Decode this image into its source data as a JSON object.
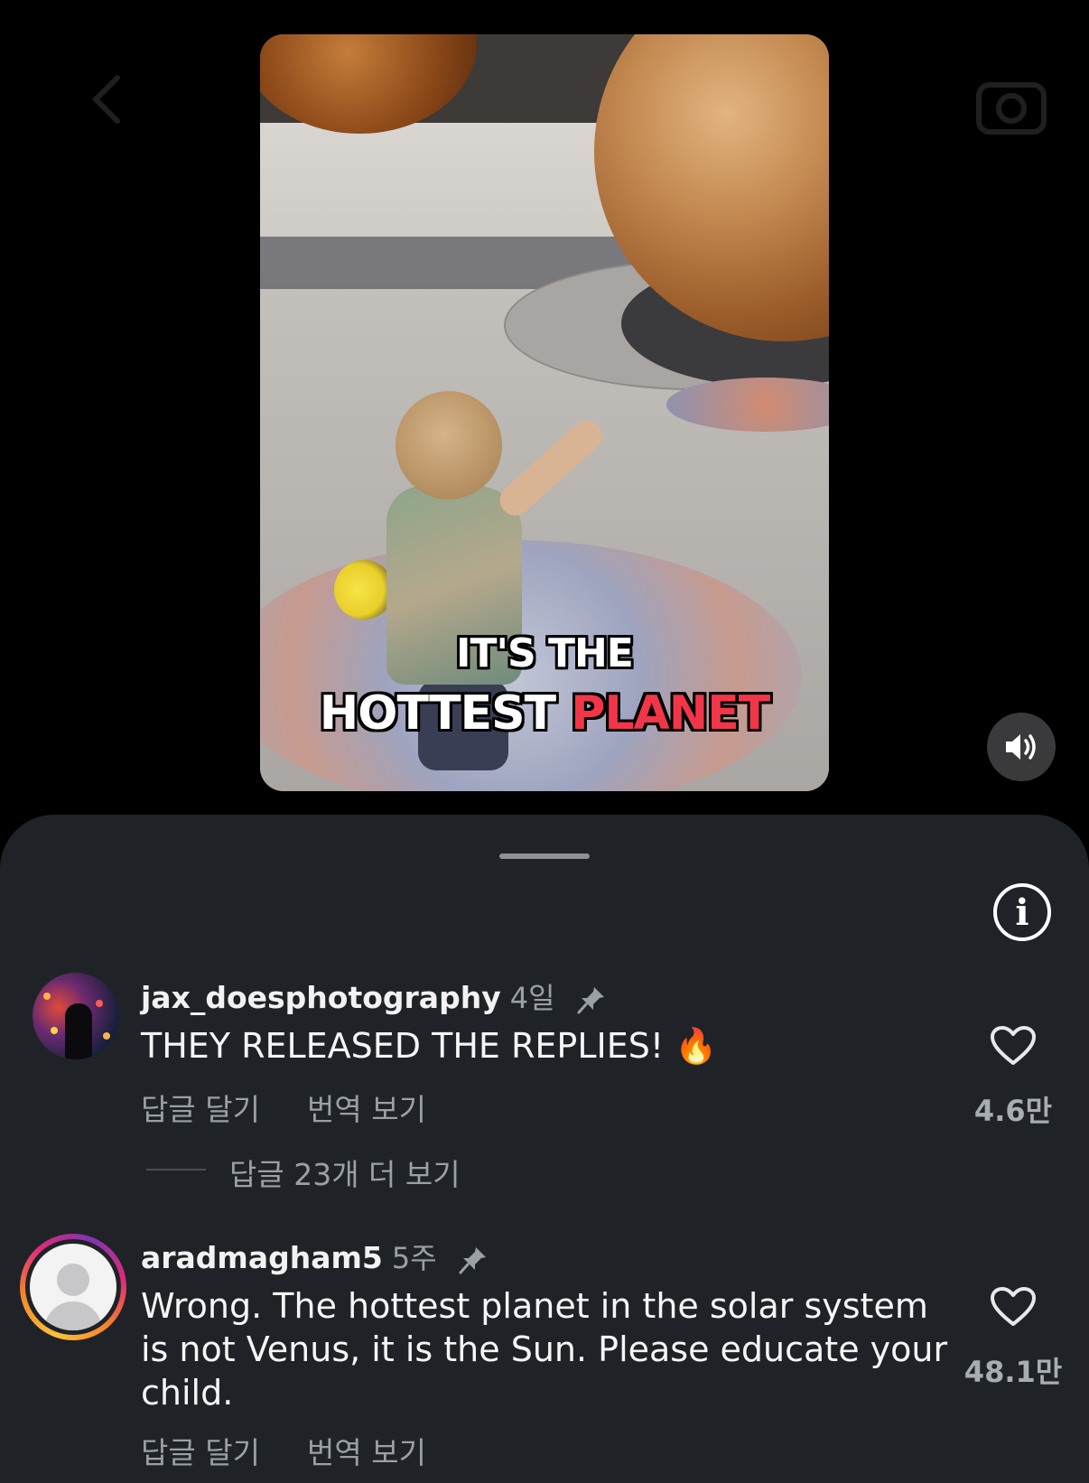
{
  "video": {
    "caption_line1": "IT'S THE",
    "caption_line2_white": "HOTTEST",
    "caption_line2_red": "PLANET",
    "caption_red_color": "#f2364a"
  },
  "controls": {
    "volume_icon": "volume-icon",
    "info_icon": "info-icon",
    "info_glyph": "i"
  },
  "comments": [
    {
      "username": "jax_doesphotography",
      "time": "4일",
      "pinned": true,
      "text": "THEY RELEASED THE REPLIES! 🔥",
      "reply_label": "답글 달기",
      "translate_label": "번역 보기",
      "likes": "4.6만",
      "view_replies": "답글 23개 더 보기"
    },
    {
      "username": "aradmagham5",
      "time": "5주",
      "pinned": true,
      "text": "Wrong. The hottest planet in the solar system is not Venus, it is the Sun. Please educate your child.",
      "reply_label": "답글 달기",
      "translate_label": "번역 보기",
      "likes": "48.1만"
    }
  ]
}
